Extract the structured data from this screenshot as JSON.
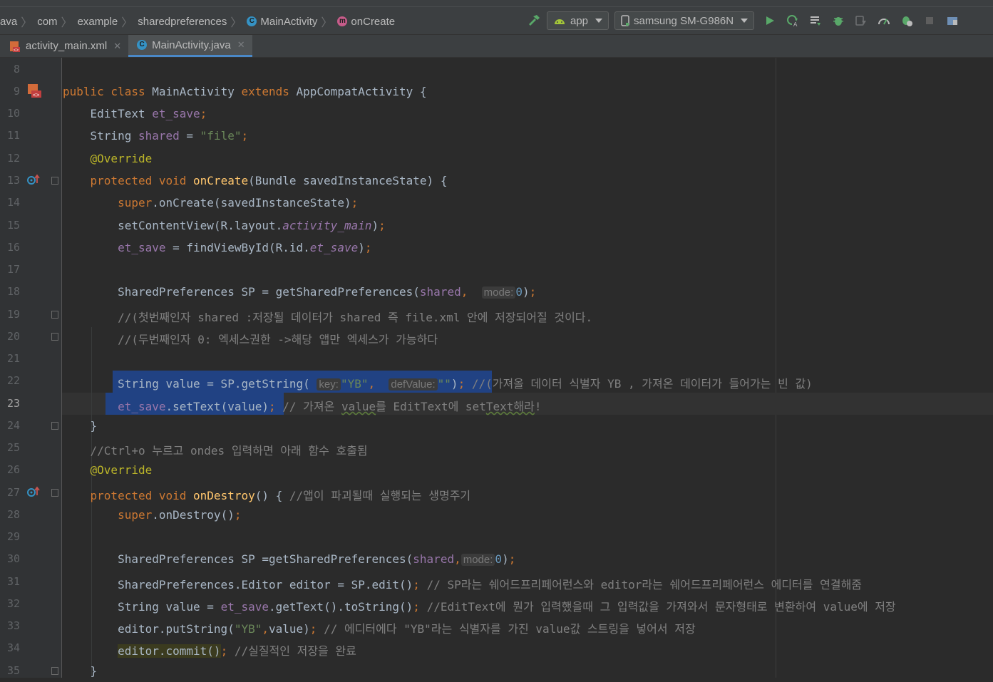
{
  "breadcrumb": [
    "ava",
    "com",
    "example",
    "sharedpreferences",
    "MainActivity",
    "onCreate"
  ],
  "toolbar": {
    "run_config": "app",
    "device": "samsung SM-G986N"
  },
  "tabs": [
    {
      "label": "activity_main.xml",
      "active": false
    },
    {
      "label": "MainActivity.java",
      "active": true
    }
  ],
  "editor": {
    "current_line": 23,
    "line_numbers": [
      "8",
      "9",
      "10",
      "11",
      "12",
      "13",
      "14",
      "15",
      "16",
      "17",
      "18",
      "19",
      "20",
      "21",
      "22",
      "23",
      "24",
      "25",
      "26",
      "27",
      "28",
      "29",
      "30",
      "31",
      "32",
      "33",
      "34",
      "35"
    ],
    "hints": {
      "mode": "mode:",
      "key": "key:",
      "defValue": "defValue:"
    },
    "comments": {
      "l19": "//(첫번째인자 shared :저장될 데이터가 shared 즉 file.xml 안에 저장되어질 것이다.",
      "l20": "//(두번째인자 0: 엑세스권한 ->해당 앱만 엑세스가 가능하다",
      "l22": "//(가져올 데이터 식별자 YB , 가져온 데이터가 들어가는 빈 값)",
      "l25": "//Ctrl+o 누르고 ondes 입력하면 아래 함수 호출됨",
      "l27": "//앱이 파괴될때 실행되는 생명주기",
      "l31": "// SP라는 쉐어드프리페어런스와 editor라는 쉐어드프리페어런스 에디터를 연결해줌",
      "l32": "//EditText에 뭔가 입력했을때 그 입력값을 가져와서 문자형태로 변환하여 value에 저장",
      "l33": "// 에디터에다 \"YB\"라는 식별자를 가진 value값 스트링을 넣어서 저장",
      "l34": "//실질적인 저장을 완료"
    }
  },
  "colors": {
    "background": "#2b2b2b",
    "keyword": "#cc7832",
    "field": "#9876aa",
    "string": "#6a8759",
    "number": "#6897bb",
    "annotation": "#bbb529",
    "method": "#ffc66d",
    "comment": "#808080",
    "selection": "#214283"
  }
}
